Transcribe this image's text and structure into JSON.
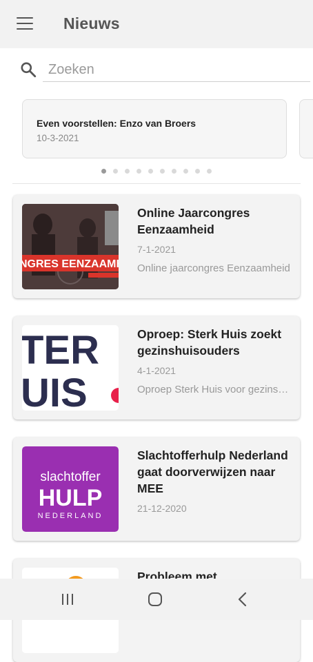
{
  "appbar": {
    "title": "Nieuws",
    "menu_icon": "menu-icon"
  },
  "search": {
    "placeholder": "Zoeken",
    "icon": "search-icon"
  },
  "carousel": {
    "slides": [
      {
        "title": "Even voorstellen:  Enzo van Broers",
        "date": "10-3-2021"
      }
    ],
    "dot_count": 10,
    "active_dot": 0
  },
  "news": [
    {
      "title": "Online Jaarcongres Eenzaamheid",
      "date": "7-1-2021",
      "excerpt": "Online jaarcongres Eenzaamheid",
      "thumb_text": "NGRES EENZAAMHEID"
    },
    {
      "title": "Oproep: Sterk Huis zoekt gezinshuisouders",
      "date": "4-1-2021",
      "excerpt": "Oproep Sterk Huis voor gezinshuisouders",
      "thumb_line1": "TER",
      "thumb_line2": "UIS"
    },
    {
      "title": "Slachtofferhulp Nederland gaat doorverwijzen  naar MEE",
      "date": "21-12-2020",
      "excerpt": "",
      "thumb_line1": "slachtoffer",
      "thumb_line2": "HULP",
      "thumb_line3": "NEDERLAND"
    },
    {
      "title": "Probleem met",
      "date": "",
      "excerpt": ""
    }
  ],
  "colors": {
    "appbar_bg": "#f2f2f2",
    "card_bg": "#f3f3f3",
    "slachtofferhulp_purple": "#9a2fb1",
    "sterkhuis_navy": "#2c2e4f"
  },
  "navbar": {
    "recent_icon": "recent-apps-icon",
    "home_icon": "home-icon",
    "back_icon": "back-icon"
  }
}
